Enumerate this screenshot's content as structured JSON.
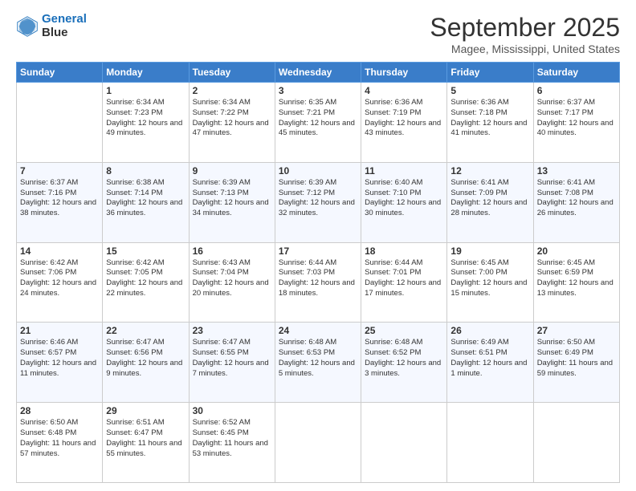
{
  "logo": {
    "line1": "General",
    "line2": "Blue"
  },
  "header": {
    "month": "September 2025",
    "location": "Magee, Mississippi, United States"
  },
  "weekdays": [
    "Sunday",
    "Monday",
    "Tuesday",
    "Wednesday",
    "Thursday",
    "Friday",
    "Saturday"
  ],
  "weeks": [
    [
      {
        "day": "",
        "sunrise": "",
        "sunset": "",
        "daylight": ""
      },
      {
        "day": "1",
        "sunrise": "Sunrise: 6:34 AM",
        "sunset": "Sunset: 7:23 PM",
        "daylight": "Daylight: 12 hours and 49 minutes."
      },
      {
        "day": "2",
        "sunrise": "Sunrise: 6:34 AM",
        "sunset": "Sunset: 7:22 PM",
        "daylight": "Daylight: 12 hours and 47 minutes."
      },
      {
        "day": "3",
        "sunrise": "Sunrise: 6:35 AM",
        "sunset": "Sunset: 7:21 PM",
        "daylight": "Daylight: 12 hours and 45 minutes."
      },
      {
        "day": "4",
        "sunrise": "Sunrise: 6:36 AM",
        "sunset": "Sunset: 7:19 PM",
        "daylight": "Daylight: 12 hours and 43 minutes."
      },
      {
        "day": "5",
        "sunrise": "Sunrise: 6:36 AM",
        "sunset": "Sunset: 7:18 PM",
        "daylight": "Daylight: 12 hours and 41 minutes."
      },
      {
        "day": "6",
        "sunrise": "Sunrise: 6:37 AM",
        "sunset": "Sunset: 7:17 PM",
        "daylight": "Daylight: 12 hours and 40 minutes."
      }
    ],
    [
      {
        "day": "7",
        "sunrise": "Sunrise: 6:37 AM",
        "sunset": "Sunset: 7:16 PM",
        "daylight": "Daylight: 12 hours and 38 minutes."
      },
      {
        "day": "8",
        "sunrise": "Sunrise: 6:38 AM",
        "sunset": "Sunset: 7:14 PM",
        "daylight": "Daylight: 12 hours and 36 minutes."
      },
      {
        "day": "9",
        "sunrise": "Sunrise: 6:39 AM",
        "sunset": "Sunset: 7:13 PM",
        "daylight": "Daylight: 12 hours and 34 minutes."
      },
      {
        "day": "10",
        "sunrise": "Sunrise: 6:39 AM",
        "sunset": "Sunset: 7:12 PM",
        "daylight": "Daylight: 12 hours and 32 minutes."
      },
      {
        "day": "11",
        "sunrise": "Sunrise: 6:40 AM",
        "sunset": "Sunset: 7:10 PM",
        "daylight": "Daylight: 12 hours and 30 minutes."
      },
      {
        "day": "12",
        "sunrise": "Sunrise: 6:41 AM",
        "sunset": "Sunset: 7:09 PM",
        "daylight": "Daylight: 12 hours and 28 minutes."
      },
      {
        "day": "13",
        "sunrise": "Sunrise: 6:41 AM",
        "sunset": "Sunset: 7:08 PM",
        "daylight": "Daylight: 12 hours and 26 minutes."
      }
    ],
    [
      {
        "day": "14",
        "sunrise": "Sunrise: 6:42 AM",
        "sunset": "Sunset: 7:06 PM",
        "daylight": "Daylight: 12 hours and 24 minutes."
      },
      {
        "day": "15",
        "sunrise": "Sunrise: 6:42 AM",
        "sunset": "Sunset: 7:05 PM",
        "daylight": "Daylight: 12 hours and 22 minutes."
      },
      {
        "day": "16",
        "sunrise": "Sunrise: 6:43 AM",
        "sunset": "Sunset: 7:04 PM",
        "daylight": "Daylight: 12 hours and 20 minutes."
      },
      {
        "day": "17",
        "sunrise": "Sunrise: 6:44 AM",
        "sunset": "Sunset: 7:03 PM",
        "daylight": "Daylight: 12 hours and 18 minutes."
      },
      {
        "day": "18",
        "sunrise": "Sunrise: 6:44 AM",
        "sunset": "Sunset: 7:01 PM",
        "daylight": "Daylight: 12 hours and 17 minutes."
      },
      {
        "day": "19",
        "sunrise": "Sunrise: 6:45 AM",
        "sunset": "Sunset: 7:00 PM",
        "daylight": "Daylight: 12 hours and 15 minutes."
      },
      {
        "day": "20",
        "sunrise": "Sunrise: 6:45 AM",
        "sunset": "Sunset: 6:59 PM",
        "daylight": "Daylight: 12 hours and 13 minutes."
      }
    ],
    [
      {
        "day": "21",
        "sunrise": "Sunrise: 6:46 AM",
        "sunset": "Sunset: 6:57 PM",
        "daylight": "Daylight: 12 hours and 11 minutes."
      },
      {
        "day": "22",
        "sunrise": "Sunrise: 6:47 AM",
        "sunset": "Sunset: 6:56 PM",
        "daylight": "Daylight: 12 hours and 9 minutes."
      },
      {
        "day": "23",
        "sunrise": "Sunrise: 6:47 AM",
        "sunset": "Sunset: 6:55 PM",
        "daylight": "Daylight: 12 hours and 7 minutes."
      },
      {
        "day": "24",
        "sunrise": "Sunrise: 6:48 AM",
        "sunset": "Sunset: 6:53 PM",
        "daylight": "Daylight: 12 hours and 5 minutes."
      },
      {
        "day": "25",
        "sunrise": "Sunrise: 6:48 AM",
        "sunset": "Sunset: 6:52 PM",
        "daylight": "Daylight: 12 hours and 3 minutes."
      },
      {
        "day": "26",
        "sunrise": "Sunrise: 6:49 AM",
        "sunset": "Sunset: 6:51 PM",
        "daylight": "Daylight: 12 hours and 1 minute."
      },
      {
        "day": "27",
        "sunrise": "Sunrise: 6:50 AM",
        "sunset": "Sunset: 6:49 PM",
        "daylight": "Daylight: 11 hours and 59 minutes."
      }
    ],
    [
      {
        "day": "28",
        "sunrise": "Sunrise: 6:50 AM",
        "sunset": "Sunset: 6:48 PM",
        "daylight": "Daylight: 11 hours and 57 minutes."
      },
      {
        "day": "29",
        "sunrise": "Sunrise: 6:51 AM",
        "sunset": "Sunset: 6:47 PM",
        "daylight": "Daylight: 11 hours and 55 minutes."
      },
      {
        "day": "30",
        "sunrise": "Sunrise: 6:52 AM",
        "sunset": "Sunset: 6:45 PM",
        "daylight": "Daylight: 11 hours and 53 minutes."
      },
      {
        "day": "",
        "sunrise": "",
        "sunset": "",
        "daylight": ""
      },
      {
        "day": "",
        "sunrise": "",
        "sunset": "",
        "daylight": ""
      },
      {
        "day": "",
        "sunrise": "",
        "sunset": "",
        "daylight": ""
      },
      {
        "day": "",
        "sunrise": "",
        "sunset": "",
        "daylight": ""
      }
    ]
  ]
}
